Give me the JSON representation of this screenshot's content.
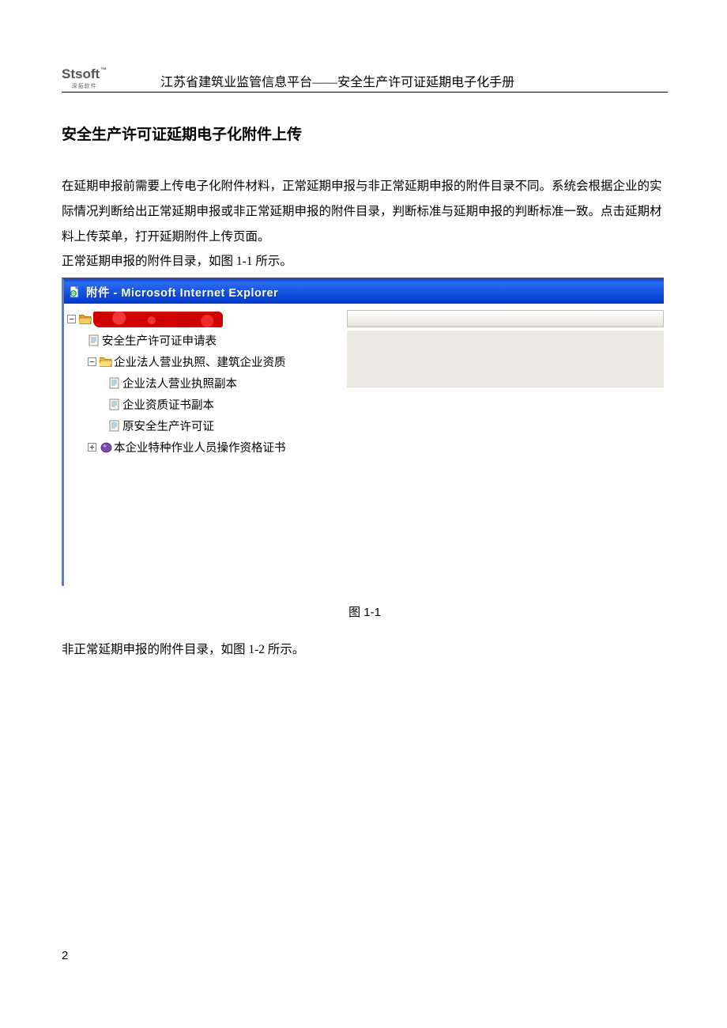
{
  "header": {
    "logo_main": "Stsoft",
    "logo_tm": "™",
    "logo_sub": "深拓软件",
    "doc_title": "江苏省建筑业监管信息平台——安全生产许可证延期电子化手册"
  },
  "section_title": "安全生产许可证延期电子化附件上传",
  "paragraph1": "在延期申报前需要上传电子化附件材料，正常延期申报与非正常延期申报的附件目录不同。系统会根据企业的实际情况判断给出正常延期申报或非正常延期申报的附件目录，判断标准与延期申报的判断标准一致。点击延期材料上传菜单，打开延期附件上传页面。",
  "paragraph2": "正常延期申报的附件目录，如图 1-1 所示。",
  "ie_window": {
    "title_prefix": "附件",
    "title_sep": " - ",
    "title_app": "Microsoft Internet Explorer",
    "tree": [
      {
        "indent": 0,
        "toggle": "−",
        "icon": "folder-red",
        "label": "",
        "redacted": true
      },
      {
        "indent": 26,
        "toggle": "",
        "icon": "file",
        "label": "安全生产许可证申请表"
      },
      {
        "indent": 26,
        "toggle": "−",
        "icon": "folder-yellow",
        "label": "企业法人营业执照、建筑企业资质"
      },
      {
        "indent": 52,
        "toggle": "",
        "icon": "file",
        "label": "企业法人营业执照副本"
      },
      {
        "indent": 52,
        "toggle": "",
        "icon": "file",
        "label": "企业资质证书副本"
      },
      {
        "indent": 52,
        "toggle": "",
        "icon": "file",
        "label": "原安全生产许可证"
      },
      {
        "indent": 26,
        "toggle": "+",
        "icon": "special",
        "label": "本企业特种作业人员操作资格证书"
      }
    ]
  },
  "figure_caption": "图 1-1",
  "paragraph3": "非正常延期申报的附件目录，如图 1-2 所示。",
  "page_number": "2"
}
